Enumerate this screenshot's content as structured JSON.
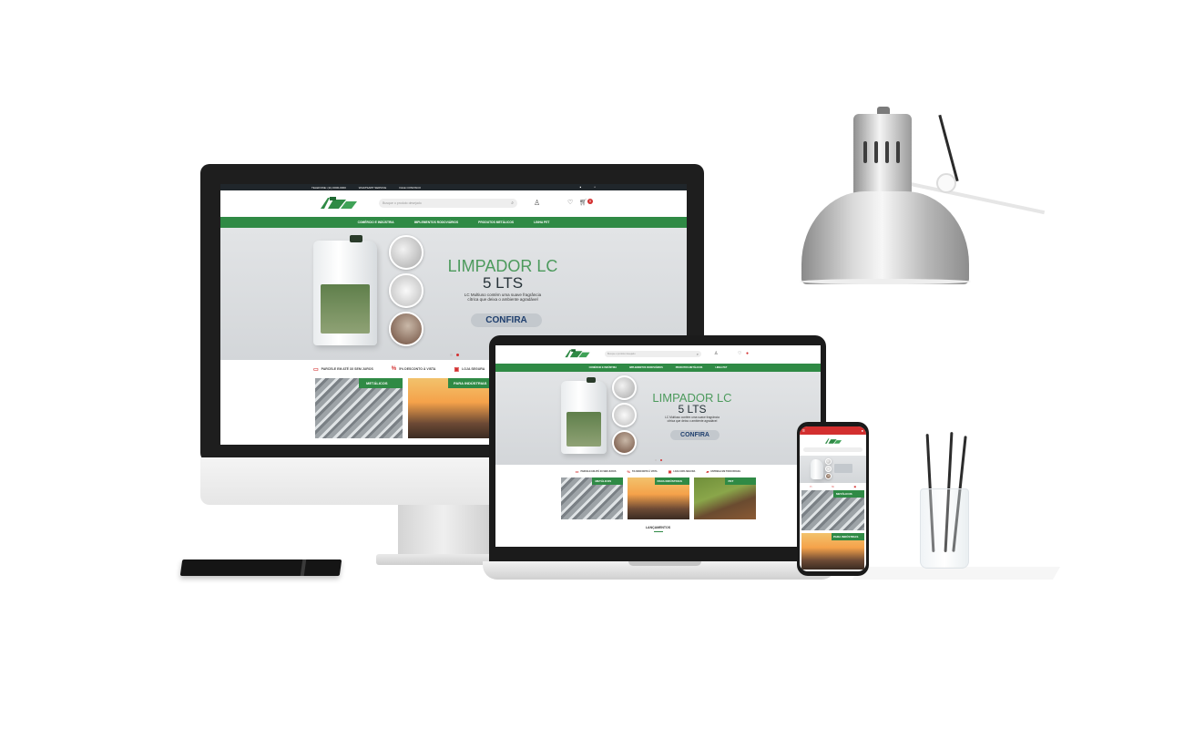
{
  "colors": {
    "brand_green": "#2f8a45",
    "headline_green": "#4c9a5c",
    "accent_red": "#d32f2f",
    "topbar_dark": "#20262b"
  },
  "icons": [
    "facebook-icon",
    "instagram-icon",
    "search-icon",
    "user-icon",
    "heart-icon",
    "cart-icon"
  ],
  "desktop": {
    "topbar": {
      "phone": "TELEFONE: (11) 0000-0000",
      "whatsapp": "WHATSAPP SERVICE",
      "contact": "FALE CONOSCO"
    },
    "search_placeholder": "Busque o produto desejado",
    "cart_count": "0",
    "nav": [
      "COMÉRCIO E INDÚSTRIA",
      "IMPLEMENTOS RODOVIÁRIOS",
      "PRODUTOS METÁLICOS",
      "LINHA PET"
    ],
    "hero": {
      "title": "LIMPADOR LC",
      "subtitle": "5 LTS",
      "description_line1": "LC Multiuso contém uma suave fragrância",
      "description_line2": "cítrica que deixa o ambiente agradável",
      "button": "CONFIRA"
    },
    "benefits": [
      "PARCELE EM ATÉ 3X SEM JUROS",
      "5% DESCONTO À VISTA",
      "LOJA SEGURA"
    ],
    "cards": [
      "METÁLICOS",
      "PARA INDÚSTRIAS"
    ]
  },
  "laptop": {
    "search_placeholder": "Busque o produto desejado",
    "nav": [
      "COMÉRCIO E INDÚSTRIA",
      "IMPLEMENTOS RODOVIÁRIOS",
      "PRODUTOS METÁLICOS",
      "LINHA PET"
    ],
    "hero": {
      "title": "LIMPADOR LC",
      "subtitle": "5 LTS",
      "description_line1": "LC Multiuso contém uma suave fragrância",
      "description_line2": "cítrica que deixa o ambiente agradável",
      "button": "CONFIRA"
    },
    "benefits": [
      "PARCELE EM ATÉ 3X SEM JUROS",
      "5% DESCONTO À VISTA",
      "LOJA 100% SEGURA",
      "ENTREGA EM TODO BRASIL"
    ],
    "cards": [
      "METÁLICOS",
      "PARA INDÚSTRIAS",
      "PET"
    ],
    "section_title": "LANÇAMENTOS"
  },
  "phone": {
    "cards": [
      "METÁLICOS",
      "PARA INDÚSTRIAS"
    ]
  }
}
